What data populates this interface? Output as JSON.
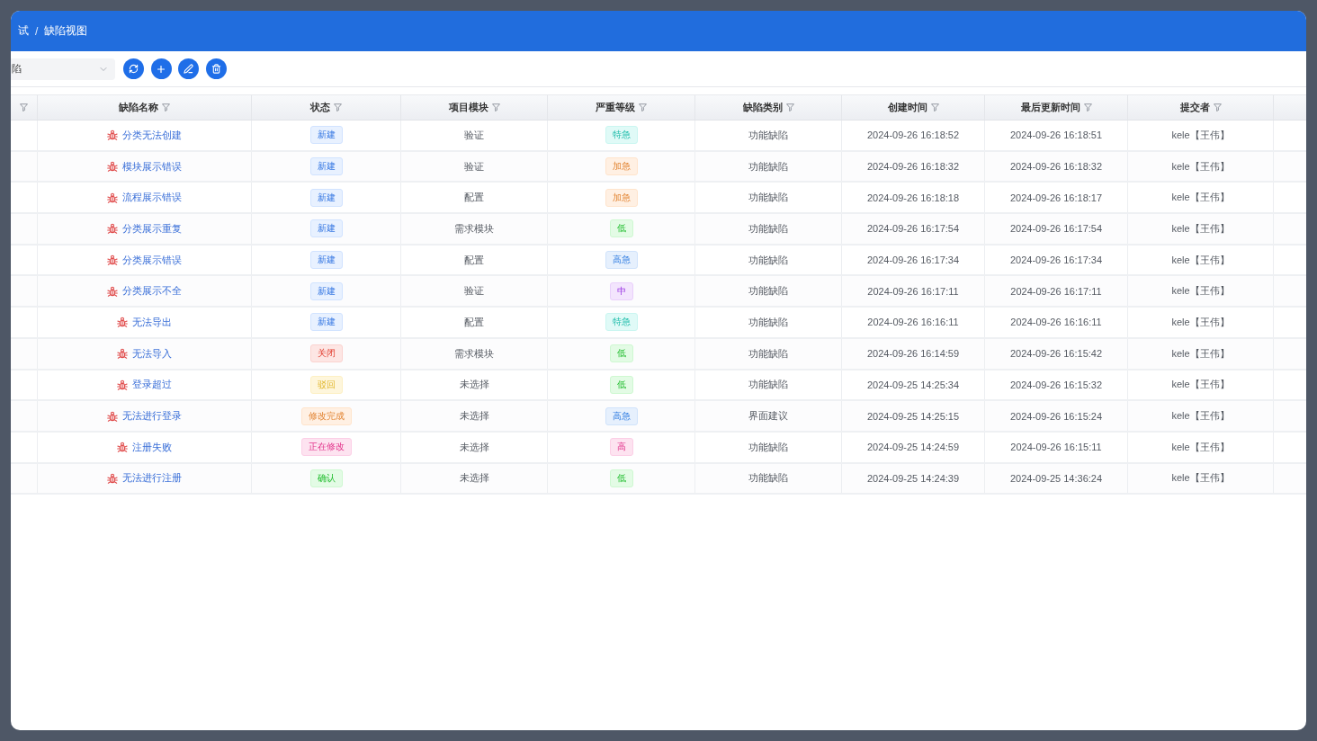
{
  "header": {
    "breadcrumb": [
      "试",
      "缺陷视图"
    ],
    "separator": "/"
  },
  "toolbar": {
    "view_select": {
      "value": "陷"
    }
  },
  "table": {
    "columns": [
      {
        "filterable": true
      },
      {
        "label": "缺陷名称",
        "filterable": true
      },
      {
        "label": "状态",
        "filterable": true
      },
      {
        "label": "项目模块",
        "filterable": true
      },
      {
        "label": "严重等级",
        "filterable": true
      },
      {
        "label": "缺陷类别",
        "filterable": true
      },
      {
        "label": "创建时间",
        "filterable": true
      },
      {
        "label": "最后更新时间",
        "filterable": true
      },
      {
        "label": "提交者",
        "filterable": true
      },
      {
        "filterable": false
      }
    ],
    "rows": [
      {
        "name": "分类无法创建",
        "status": {
          "label": "新建",
          "color": "#e8f1ff"
        },
        "module": "验证",
        "severity": {
          "label": "特急",
          "color": "#e0faf7"
        },
        "category": "功能缺陷",
        "created": "2024-09-26 16:18:52",
        "updated": "2024-09-26 16:18:51",
        "submitter": "kele【王伟】"
      },
      {
        "name": "模块展示错误",
        "status": {
          "label": "新建",
          "color": "#e8f1ff"
        },
        "module": "验证",
        "severity": {
          "label": "加急",
          "color": "#fff0e3"
        },
        "category": "功能缺陷",
        "created": "2024-09-26 16:18:32",
        "updated": "2024-09-26 16:18:32",
        "submitter": "kele【王伟】"
      },
      {
        "name": "流程展示错误",
        "status": {
          "label": "新建",
          "color": "#e8f1ff"
        },
        "module": "配置",
        "severity": {
          "label": "加急",
          "color": "#fff0e3"
        },
        "category": "功能缺陷",
        "created": "2024-09-26 16:18:18",
        "updated": "2024-09-26 16:18:17",
        "submitter": "kele【王伟】"
      },
      {
        "name": "分类展示重复",
        "status": {
          "label": "新建",
          "color": "#e8f1ff"
        },
        "module": "需求模块",
        "severity": {
          "label": "低",
          "color": "#e3fbe5"
        },
        "category": "功能缺陷",
        "created": "2024-09-26 16:17:54",
        "updated": "2024-09-26 16:17:54",
        "submitter": "kele【王伟】"
      },
      {
        "name": "分类展示错误",
        "status": {
          "label": "新建",
          "color": "#e8f1ff"
        },
        "module": "配置",
        "severity": {
          "label": "高急",
          "color": "#e6f0fd"
        },
        "category": "功能缺陷",
        "created": "2024-09-26 16:17:34",
        "updated": "2024-09-26 16:17:34",
        "submitter": "kele【王伟】"
      },
      {
        "name": "分类展示不全",
        "status": {
          "label": "新建",
          "color": "#e8f1ff"
        },
        "module": "验证",
        "severity": {
          "label": "中",
          "color": "#f3e5fd"
        },
        "category": "功能缺陷",
        "created": "2024-09-26 16:17:11",
        "updated": "2024-09-26 16:17:11",
        "submitter": "kele【王伟】"
      },
      {
        "name": "无法导出",
        "status": {
          "label": "新建",
          "color": "#e8f1ff"
        },
        "module": "配置",
        "severity": {
          "label": "特急",
          "color": "#e0faf7"
        },
        "category": "功能缺陷",
        "created": "2024-09-26 16:16:11",
        "updated": "2024-09-26 16:16:11",
        "submitter": "kele【王伟】"
      },
      {
        "name": "无法导入",
        "status": {
          "label": "关闭",
          "color": "#fde6e4"
        },
        "module": "需求模块",
        "severity": {
          "label": "低",
          "color": "#e3fbe5"
        },
        "category": "功能缺陷",
        "created": "2024-09-26 16:14:59",
        "updated": "2024-09-26 16:15:42",
        "submitter": "kele【王伟】"
      },
      {
        "name": "登录超过",
        "status": {
          "label": "驳回",
          "color": "#fef6dc"
        },
        "module": "未选择",
        "severity": {
          "label": "低",
          "color": "#e3fbe5"
        },
        "category": "功能缺陷",
        "created": "2024-09-25 14:25:34",
        "updated": "2024-09-26 16:15:32",
        "submitter": "kele【王伟】"
      },
      {
        "name": "无法进行登录",
        "status": {
          "label": "修改完成",
          "color": "#fff0e3"
        },
        "module": "未选择",
        "severity": {
          "label": "高急",
          "color": "#e6f0fd"
        },
        "category": "界面建议",
        "created": "2024-09-25 14:25:15",
        "updated": "2024-09-26 16:15:24",
        "submitter": "kele【王伟】"
      },
      {
        "name": "注册失败",
        "status": {
          "label": "正在修改",
          "color": "#fde3f0"
        },
        "module": "未选择",
        "severity": {
          "label": "高",
          "color": "#fde3f0"
        },
        "category": "功能缺陷",
        "created": "2024-09-25 14:24:59",
        "updated": "2024-09-26 16:15:11",
        "submitter": "kele【王伟】"
      },
      {
        "name": "无法进行注册",
        "status": {
          "label": "确认",
          "color": "#e3fbe5"
        },
        "module": "未选择",
        "severity": {
          "label": "低",
          "color": "#e3fbe5"
        },
        "category": "功能缺陷",
        "created": "2024-09-25 14:24:39",
        "updated": "2024-09-25 14:36:24",
        "submitter": "kele【王伟】"
      }
    ]
  }
}
